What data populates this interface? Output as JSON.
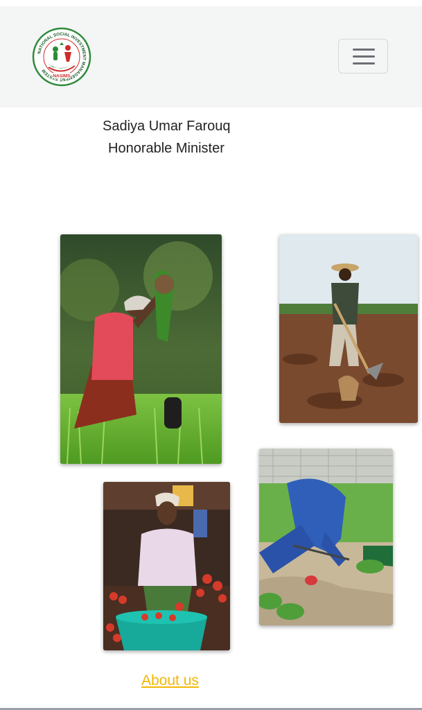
{
  "header": {
    "logo_text": "NATIONAL SOCIAL INVESTMENT MANAGEMENT SYSTEM",
    "logo_badge": "NASIMS",
    "menu_icon": "hamburger-menu-icon"
  },
  "profile": {
    "name": "Sadiya Umar Farouq",
    "title": "Honorable Minister"
  },
  "gallery": {
    "images": [
      "woman-planting-rice-photo",
      "farmer-hoeing-field-photo",
      "woman-selling-tomatoes-photo",
      "worker-tending-garden-photo"
    ]
  },
  "footer": {
    "about_link": "About us"
  },
  "colors": {
    "navbar_bg": "#f4f5f5",
    "link": "#f2b705",
    "logo_green": "#2e8b3a",
    "logo_red": "#d02a2a"
  }
}
